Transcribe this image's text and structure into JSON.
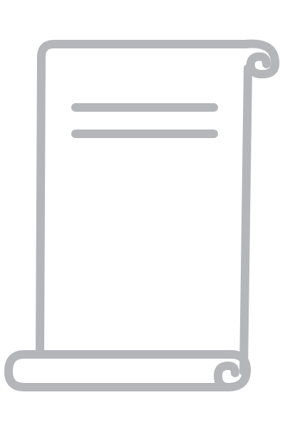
{
  "icon": {
    "name": "scroll-document-icon",
    "stroke_color": "#b5b6ba",
    "background_color": "#ffffff",
    "text_line_count": 2
  }
}
